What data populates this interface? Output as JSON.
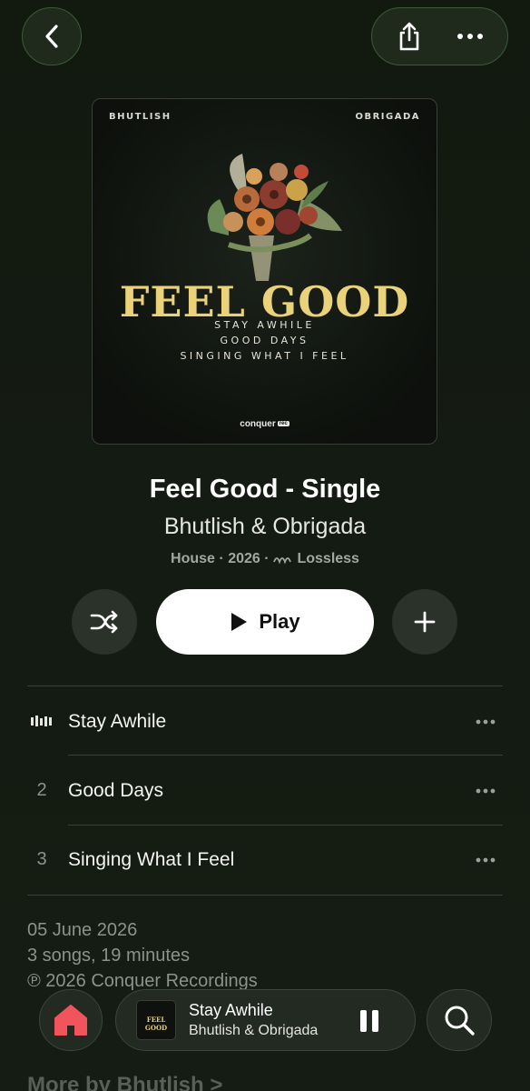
{
  "cover": {
    "artist_left": "BHUTLISH",
    "artist_right": "OBRIGADA",
    "title": "FEEL GOOD",
    "tracks": [
      "STAY AWHILE",
      "GOOD DAYS",
      "SINGING WHAT I FEEL"
    ],
    "label": "conquer",
    "label_badge": "rec"
  },
  "album": {
    "title": "Feel Good - Single",
    "artist": "Bhutlish & Obrigada",
    "genre": "House",
    "year": "2026",
    "quality": "Lossless",
    "sep": "·"
  },
  "controls": {
    "play_label": "Play"
  },
  "tracks": [
    {
      "number": "",
      "title": "Stay Awhile",
      "playing": true
    },
    {
      "number": "2",
      "title": "Good Days",
      "playing": false
    },
    {
      "number": "3",
      "title": "Singing What I Feel",
      "playing": false
    }
  ],
  "info": {
    "release_date": "05 June 2026",
    "count_duration": "3 songs, 19 minutes",
    "copyright": "℗ 2026 Conquer Recordings"
  },
  "more_by": "More by Bhutlish >",
  "now_playing": {
    "title": "Stay Awhile",
    "artist": "Bhutlish & Obrigada",
    "art_text": "FEEL GOOD"
  },
  "colors": {
    "background": "#141b12",
    "accent_home": "#f2545b",
    "cover_title": "#e9d27a"
  },
  "icons": [
    "chevron-left-icon",
    "share-icon",
    "more-icon",
    "shuffle-icon",
    "play-icon",
    "plus-icon",
    "waveform-icon",
    "home-icon",
    "pause-icon",
    "search-icon",
    "lossless-icon"
  ]
}
